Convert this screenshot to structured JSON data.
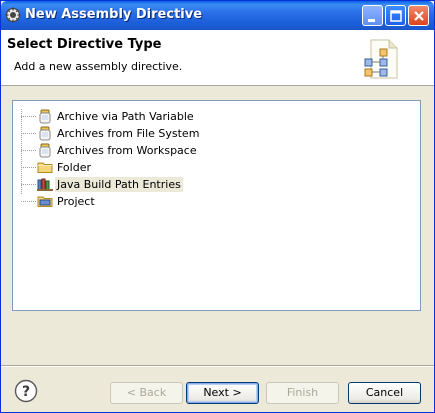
{
  "window": {
    "title": "New Assembly Directive"
  },
  "banner": {
    "title": "Select Directive Type",
    "description": "Add a new assembly directive."
  },
  "tree": {
    "items": [
      {
        "label": "Archive via Path Variable",
        "icon": "jar-icon"
      },
      {
        "label": "Archives from File System",
        "icon": "jar-icon"
      },
      {
        "label": "Archives from Workspace",
        "icon": "jar-icon"
      },
      {
        "label": "Folder",
        "icon": "folder-icon"
      },
      {
        "label": "Java Build Path Entries",
        "icon": "library-icon",
        "selected": true
      },
      {
        "label": "Project",
        "icon": "project-icon"
      }
    ]
  },
  "buttons": {
    "back": "< Back",
    "next": "Next >",
    "finish": "Finish",
    "cancel": "Cancel"
  },
  "help": {
    "glyph": "?"
  }
}
